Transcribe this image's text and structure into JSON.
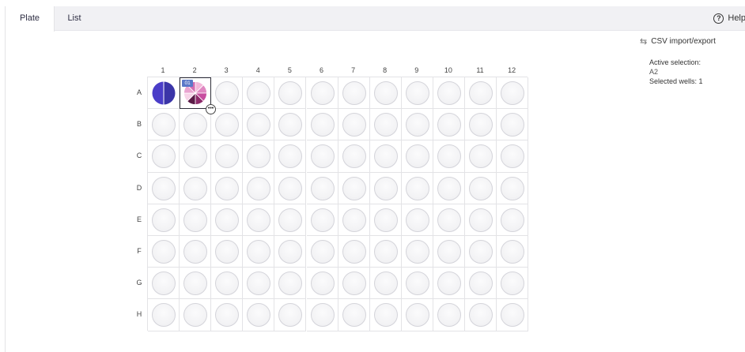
{
  "tabs": [
    {
      "label": "Plate",
      "active": true
    },
    {
      "label": "List",
      "active": false
    }
  ],
  "help": {
    "label": "Help",
    "icon": "help-circle-icon"
  },
  "side": {
    "csv_label": "CSV import/export",
    "csv_icon": "swap-arrows-icon",
    "active_selection_label": "Active selection:",
    "active_selection_value": "A2",
    "selected_wells_label": "Selected wells:",
    "selected_wells_value": "1"
  },
  "plate": {
    "columns": [
      "1",
      "2",
      "3",
      "4",
      "5",
      "6",
      "7",
      "8",
      "9",
      "10",
      "11",
      "12"
    ],
    "rows": [
      "A",
      "B",
      "C",
      "D",
      "E",
      "F",
      "G",
      "H"
    ],
    "active_well": "A2",
    "filled_wells": {
      "A1": {
        "type": "split",
        "colors": [
          "#4a3dc8",
          "#3b35a8"
        ]
      },
      "A2": {
        "type": "pie",
        "badge": "01",
        "colors": [
          "#f4b8da",
          "#e088c2",
          "#c84ea0",
          "#8c2a6a",
          "#5a1b47",
          "#f7d3e8",
          "#e9a3d0",
          "#d46db1"
        ]
      }
    },
    "more_button_label": "•••"
  }
}
